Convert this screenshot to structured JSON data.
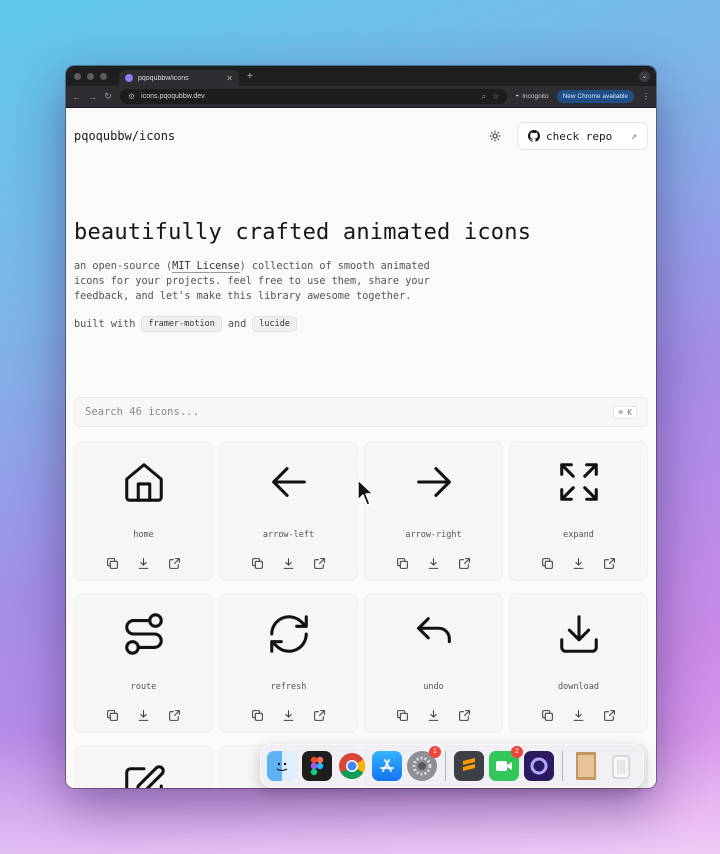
{
  "browser": {
    "tab_title": "pqoqubbw/icons",
    "url": "icons.pqoqubbw.dev",
    "incognito_label": "Incognito",
    "update_label": "New Chrome available"
  },
  "header": {
    "brand": "pqoqubbw/icons",
    "theme_toggle_icon": "sun-icon",
    "repo_button_label": "check repo"
  },
  "hero": {
    "title": "beautifully crafted animated icons",
    "desc_prefix": "an open-source (",
    "license_link": "MIT License",
    "desc_suffix": ") collection of smooth animated icons for your projects. feel free to use them, share your feedback, and let's make this library awesome together.",
    "built_with_label": "built with",
    "chip_1": "framer-motion",
    "and_label": "and",
    "chip_2": "lucide"
  },
  "search": {
    "placeholder": "Search 46 icons...",
    "shortcut": "⌘ K"
  },
  "icons": [
    {
      "name": "home"
    },
    {
      "name": "arrow-left"
    },
    {
      "name": "arrow-right"
    },
    {
      "name": "expand"
    },
    {
      "name": "route"
    },
    {
      "name": "refresh"
    },
    {
      "name": "undo"
    },
    {
      "name": "download"
    }
  ],
  "card_actions": [
    "copy-icon",
    "download-icon",
    "external-link-icon"
  ],
  "dock": {
    "apps": [
      "finder",
      "figma",
      "chrome",
      "app-store",
      "system-settings",
      "sublime-text",
      "facetime",
      "arc",
      "preview",
      "trash"
    ],
    "settings_badge": "1",
    "facetime_badge": "2"
  }
}
